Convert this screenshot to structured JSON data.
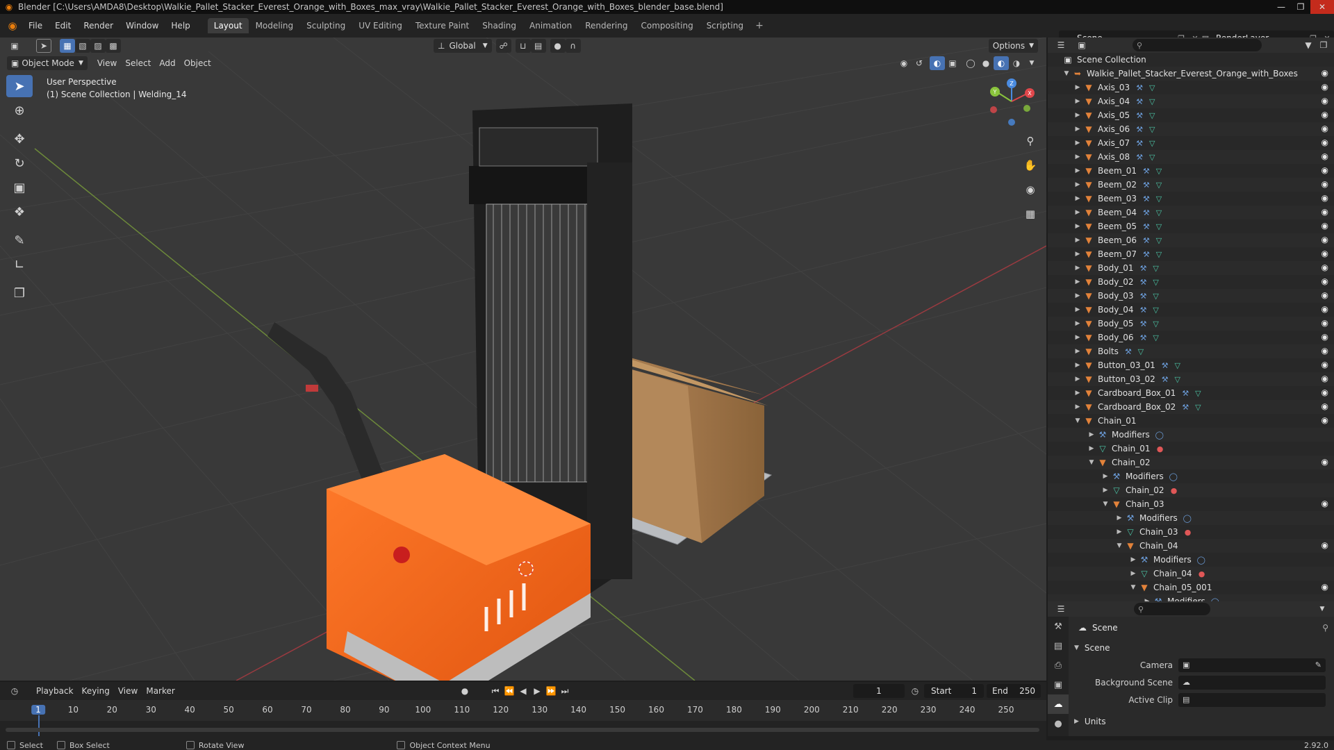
{
  "window": {
    "title": "Blender [C:\\Users\\AMDA8\\Desktop\\Walkie_Pallet_Stacker_Everest_Orange_with_Boxes_max_vray\\Walkie_Pallet_Stacker_Everest_Orange_with_Boxes_blender_base.blend]"
  },
  "menu": [
    "File",
    "Edit",
    "Render",
    "Window",
    "Help"
  ],
  "workspaces": [
    {
      "label": "Layout",
      "active": true
    },
    {
      "label": "Modeling"
    },
    {
      "label": "Sculpting"
    },
    {
      "label": "UV Editing"
    },
    {
      "label": "Texture Paint"
    },
    {
      "label": "Shading"
    },
    {
      "label": "Animation"
    },
    {
      "label": "Rendering"
    },
    {
      "label": "Compositing"
    },
    {
      "label": "Scripting"
    }
  ],
  "workspace_add": "+",
  "scene_field": "Scene",
  "render_layer_field": "RenderLayer",
  "viewport": {
    "transform_orientation": "Global",
    "options_label": "Options",
    "mode": "Object Mode",
    "menus": [
      "View",
      "Select",
      "Add",
      "Object"
    ],
    "info_line1": "User Perspective",
    "info_line2": "(1) Scene Collection | Welding_14"
  },
  "gizmo": {
    "x": "X",
    "y": "Y",
    "z": "Z"
  },
  "outliner": {
    "root": "Scene Collection",
    "collection": "Walkie_Pallet_Stacker_Everest_Orange_with_Boxes",
    "objects": [
      "Axis_03",
      "Axis_04",
      "Axis_05",
      "Axis_06",
      "Axis_07",
      "Axis_08",
      "Beem_01",
      "Beem_02",
      "Beem_03",
      "Beem_04",
      "Beem_05",
      "Beem_06",
      "Beem_07",
      "Body_01",
      "Body_02",
      "Body_03",
      "Body_04",
      "Body_05",
      "Body_06",
      "Bolts",
      "Button_03_01",
      "Button_03_02",
      "Cardboard_Box_01",
      "Cardboard_Box_02"
    ],
    "chain_tree": [
      {
        "label": "Chain_01",
        "type": "object",
        "depth": 0,
        "expanded": true,
        "eye": true
      },
      {
        "label": "Modifiers",
        "type": "modifiers",
        "depth": 1
      },
      {
        "label": "Chain_01",
        "type": "mesh",
        "depth": 1
      },
      {
        "label": "Chain_02",
        "type": "object",
        "depth": 1,
        "expanded": true,
        "eye": true
      },
      {
        "label": "Modifiers",
        "type": "modifiers",
        "depth": 2
      },
      {
        "label": "Chain_02",
        "type": "mesh",
        "depth": 2
      },
      {
        "label": "Chain_03",
        "type": "object",
        "depth": 2,
        "expanded": true,
        "eye": true
      },
      {
        "label": "Modifiers",
        "type": "modifiers",
        "depth": 3
      },
      {
        "label": "Chain_03",
        "type": "mesh",
        "depth": 3
      },
      {
        "label": "Chain_04",
        "type": "object",
        "depth": 3,
        "expanded": true,
        "eye": true
      },
      {
        "label": "Modifiers",
        "type": "modifiers",
        "depth": 4
      },
      {
        "label": "Chain_04",
        "type": "mesh",
        "depth": 4
      },
      {
        "label": "Chain_05_001",
        "type": "object",
        "depth": 4,
        "expanded": true,
        "eye": true
      },
      {
        "label": "Modifiers",
        "type": "modifiers",
        "depth": 5
      }
    ]
  },
  "properties": {
    "context_title": "Scene",
    "panel": "Scene",
    "camera_label": "Camera",
    "background_scene_label": "Background Scene",
    "active_clip_label": "Active Clip",
    "units_panel": "Units"
  },
  "timeline": {
    "menus": [
      "Playback",
      "Keying",
      "View",
      "Marker"
    ],
    "current_frame": "1",
    "start_label": "Start",
    "start_value": "1",
    "end_label": "End",
    "end_value": "250",
    "ruler": [
      "1",
      "10",
      "20",
      "30",
      "40",
      "50",
      "60",
      "70",
      "80",
      "90",
      "100",
      "110",
      "120",
      "130",
      "140",
      "150",
      "160",
      "170",
      "180",
      "190",
      "200",
      "210",
      "220",
      "230",
      "240",
      "250"
    ]
  },
  "statusbar": {
    "select": "Select",
    "box_select": "Box Select",
    "rotate_view": "Rotate View",
    "context_menu": "Object Context Menu",
    "version": "2.92.0"
  },
  "colors": {
    "accent_blue": "#4772b3",
    "viewport_bg": "#393939",
    "x_axis": "#e0474b",
    "y_axis": "#8ac43c",
    "z_axis": "#4a8be0",
    "stacker_orange": "#f2651a"
  }
}
